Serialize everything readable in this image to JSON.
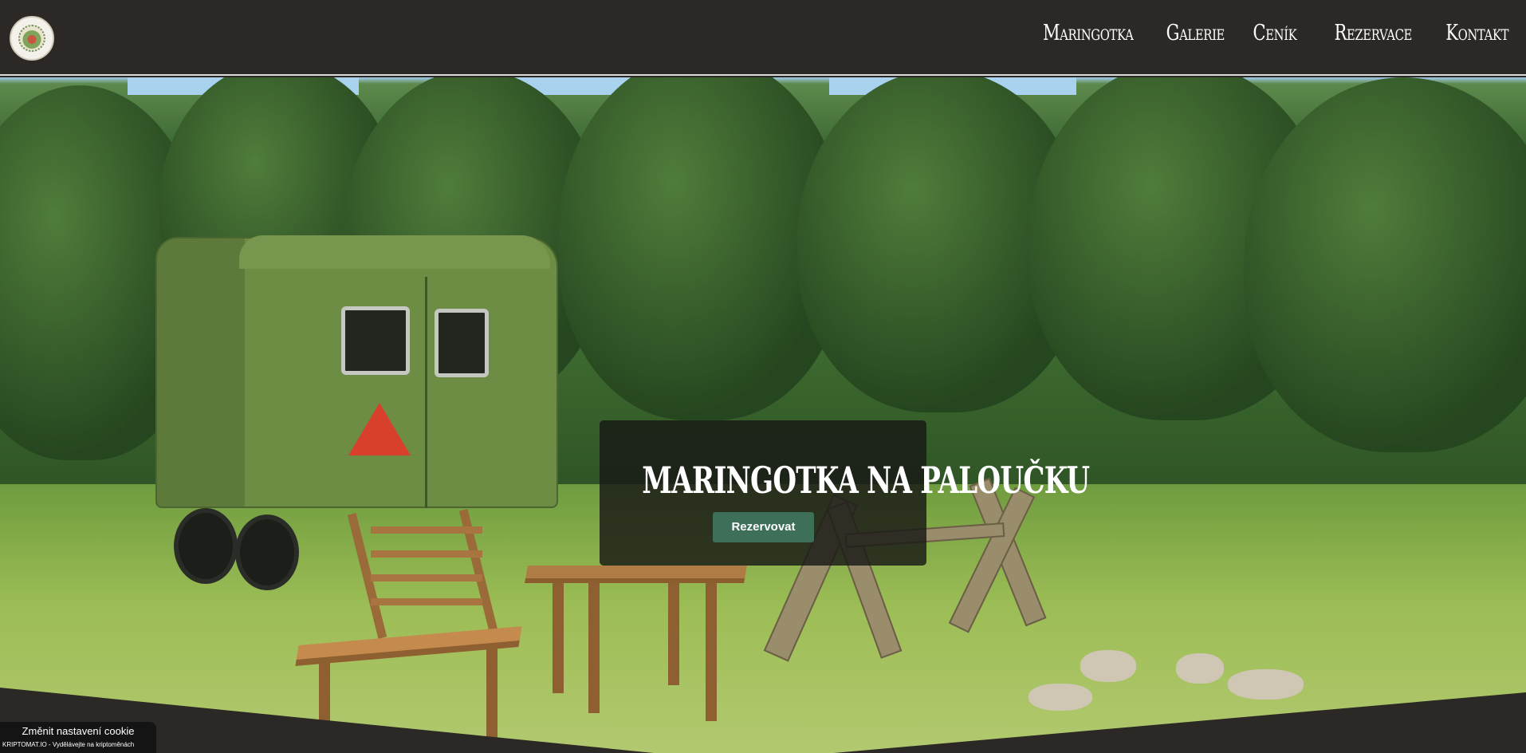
{
  "header": {
    "logo_icon": "round-badge-logo",
    "nav": [
      {
        "label": "Maringotka"
      },
      {
        "label": "Galerie"
      },
      {
        "label": "Ceník"
      },
      {
        "label": "Rezervace"
      },
      {
        "label": "Kontakt"
      }
    ]
  },
  "hero": {
    "title": "Maringotka na paloučku",
    "button_label": "Rezervovat",
    "button_color": "#3e6f58"
  },
  "cookie_bar": {
    "title": "Změnit nastavení cookie",
    "subtitle": "KRIPTOMAT.IO - Vydělávejte na kriptoměnách"
  },
  "colors": {
    "header_bg": "#2b2825",
    "overlay_bg": "rgba(24,24,22,0.82)"
  }
}
